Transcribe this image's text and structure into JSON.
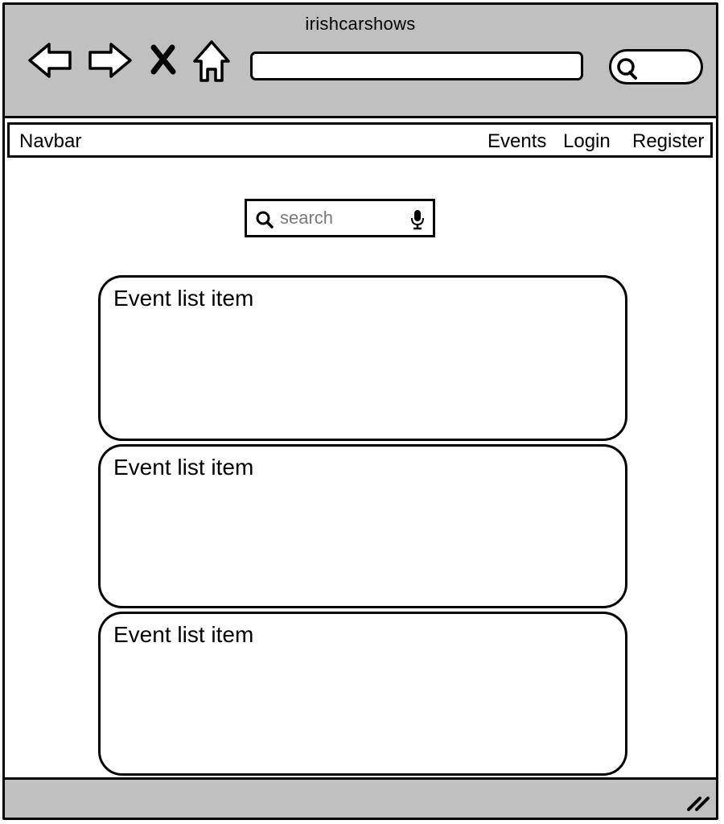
{
  "window": {
    "title": "irishcarshows",
    "toolbar": {
      "back_icon": "back-arrow-icon",
      "forward_icon": "forward-arrow-icon",
      "stop_icon": "close-icon",
      "home_icon": "home-icon",
      "address_value": "",
      "search_icon": "search-icon"
    }
  },
  "navbar": {
    "brand": "Navbar",
    "links": [
      "Events",
      "Login",
      "Register"
    ]
  },
  "search": {
    "placeholder": "search",
    "mag_icon": "search-icon",
    "mic_icon": "microphone-icon"
  },
  "events": [
    {
      "label": "Event list item"
    },
    {
      "label": "Event list item"
    },
    {
      "label": "Event list item"
    }
  ],
  "statusbar": {
    "grip_icon": "resize-grip-icon"
  }
}
